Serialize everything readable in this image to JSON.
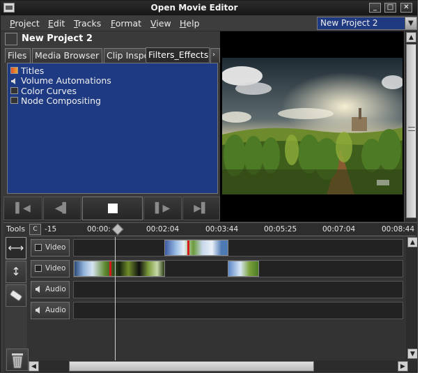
{
  "window": {
    "title": "Open Movie Editor",
    "controls": [
      "_",
      "□",
      "✕"
    ]
  },
  "menu": {
    "items": [
      "Project",
      "Edit",
      "Tracks",
      "Format",
      "View",
      "Help"
    ],
    "project_selector": "New Project 2"
  },
  "project": {
    "name": "New Project 2"
  },
  "tabs": [
    {
      "label": "Files",
      "active": false
    },
    {
      "label": "Media Browser",
      "active": false
    },
    {
      "label": "Clip Inspector",
      "active": false
    },
    {
      "label": "Filters_Effects",
      "active": true
    }
  ],
  "filters": [
    {
      "label": "Titles",
      "icon": "titles-icon"
    },
    {
      "label": "Volume Automations",
      "icon": "speaker-icon"
    },
    {
      "label": "Color Curves",
      "icon": "filter-icon"
    },
    {
      "label": "Node Compositing",
      "icon": "filter-icon"
    }
  ],
  "transport": {
    "buttons": [
      "skip-back",
      "step-back",
      "stop",
      "step-forward",
      "skip-forward"
    ]
  },
  "timeline": {
    "tools_label": "Tools",
    "ruler_labels": [
      "-15",
      "00:00:",
      "00:02:04",
      "00:03:44",
      "00:05:25",
      "00:07:04",
      "00:08:44"
    ],
    "tracks": [
      {
        "type": "Video"
      },
      {
        "type": "Video"
      },
      {
        "type": "Audio"
      },
      {
        "type": "Audio"
      }
    ]
  },
  "colors": {
    "list_bg": "#1e3a82",
    "window_bg": "#3a3a3a",
    "lane_bg": "#222222"
  }
}
